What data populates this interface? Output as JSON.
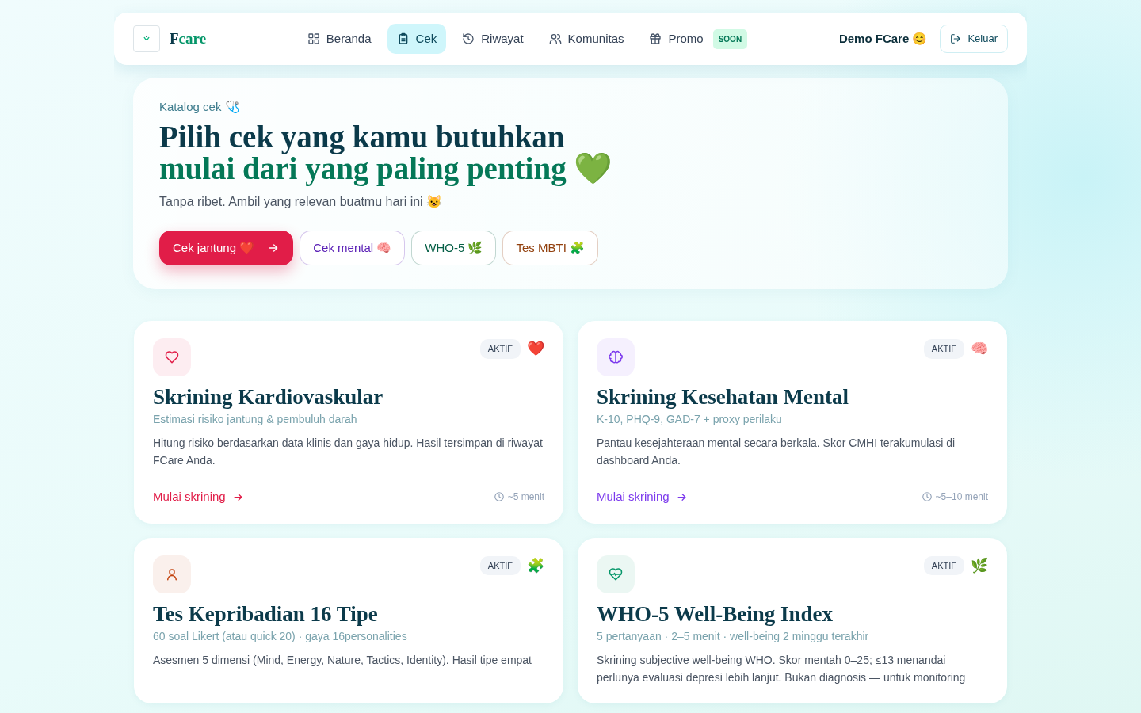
{
  "brand": {
    "name_dark": "F",
    "name_green": "care"
  },
  "nav": [
    {
      "label": "Beranda",
      "selected": false
    },
    {
      "label": "Cek",
      "selected": true
    },
    {
      "label": "Riwayat",
      "selected": false
    },
    {
      "label": "Komunitas",
      "selected": false
    },
    {
      "label": "Promo",
      "selected": false,
      "badge": "SOON"
    }
  ],
  "user": {
    "name": "Demo FCare 😊",
    "logout": "Keluar"
  },
  "hero": {
    "eyebrow": "Katalog cek 🩺",
    "title_line1": "Pilih cek yang kamu butuhkan",
    "title_line2": "mulai dari yang paling penting 💚",
    "subtitle": "Tanpa ribet. Ambil yang relevan buatmu hari ini 😺",
    "buttons": [
      {
        "kind": "primary",
        "label": "Cek jantung ❤️",
        "color": "#e11d48"
      },
      {
        "kind": "outline",
        "label": "Cek mental 🧠",
        "color": "#5b21b6"
      },
      {
        "kind": "outline",
        "label": "WHO-5 🌿",
        "color": "#065f46"
      },
      {
        "kind": "outline",
        "label": "Tes MBTI 🧩",
        "color": "#92400e"
      }
    ]
  },
  "cards": [
    {
      "color": "#e11d48",
      "badge": "AKTIF",
      "emoji": "❤️",
      "title": "Skrining Kardiovaskular",
      "subtitle": "Estimasi risiko jantung & pembuluh darah",
      "description": "Hitung risiko berdasarkan data klinis dan gaya hidup. Hasil tersimpan di riwayat FCare Anda.",
      "link": "Mulai skrining",
      "duration": "~5 menit"
    },
    {
      "color": "#7c3aed",
      "badge": "AKTIF",
      "emoji": "🧠",
      "title": "Skrining Kesehatan Mental",
      "subtitle": "K-10, PHQ-9, GAD-7 + proxy perilaku",
      "description": "Pantau kesejahteraan mental secara berkala. Skor CMHI terakumulasi di dashboard Anda.",
      "link": "Mulai skrining",
      "duration": "~5–10 menit"
    },
    {
      "color": "#c2410c",
      "badge": "AKTIF",
      "emoji": "🧩",
      "title": "Tes Kepribadian 16 Tipe",
      "subtitle": "60 soal Likert (atau quick 20) · gaya 16personalities",
      "description": "Asesmen 5 dimensi (Mind, Energy, Nature, Tactics, Identity). Hasil tipe empat"
    },
    {
      "color": "#059669",
      "badge": "AKTIF",
      "emoji": "🌿",
      "title": "WHO-5 Well-Being Index",
      "subtitle": "5 pertanyaan · 2–5 menit · well-being 2 minggu terakhir",
      "description": "Skrining subjective well-being WHO. Skor mentah 0–25; ≤13 menandai perlunya evaluasi depresi lebih lanjut. Bukan diagnosis — untuk monitoring"
    }
  ]
}
